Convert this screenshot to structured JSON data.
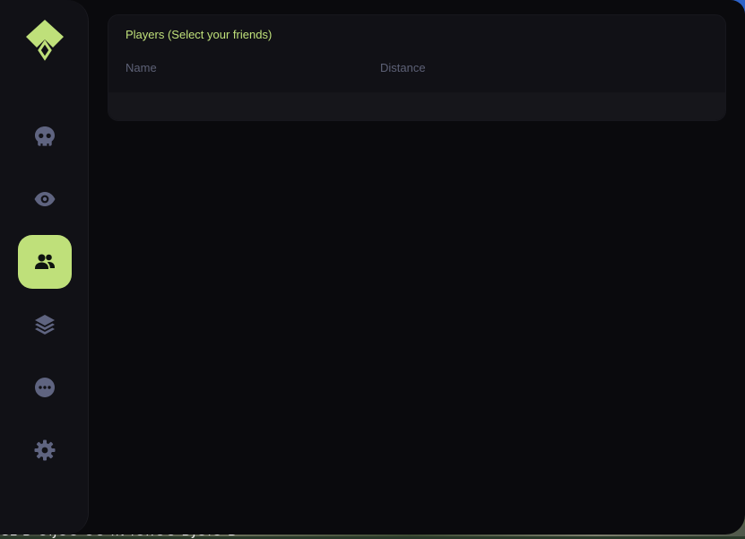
{
  "colors": {
    "accent": "#bfe07a",
    "sidebar_bg": "#111116",
    "icon_inactive": "#5f6480",
    "icon_active": "#0f1410",
    "window_bg": "#0a0a0d"
  },
  "sidebar": {
    "items": [
      {
        "icon": "skull-icon",
        "active": false
      },
      {
        "icon": "eye-icon",
        "active": false
      },
      {
        "icon": "users-icon",
        "active": true
      },
      {
        "icon": "layers-icon",
        "active": false
      },
      {
        "icon": "more-icon",
        "active": false
      },
      {
        "icon": "gear-icon",
        "active": false
      }
    ]
  },
  "players_panel": {
    "title": "Players (Select your friends)",
    "columns": [
      "Name",
      "Distance"
    ],
    "rows": []
  },
  "background": {
    "bottom_text": "CL D OIJOO OO IN IO..OO DJOIO D"
  }
}
